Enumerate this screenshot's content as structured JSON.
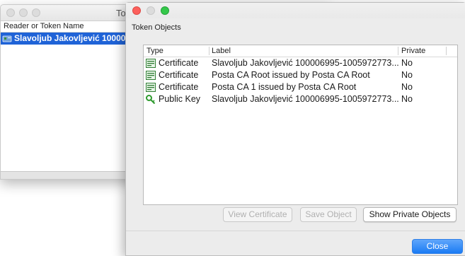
{
  "back_window": {
    "title": "Tok",
    "column_header": "Reader or Token Name",
    "selected_row": "Slavoljub Jakovljević 10000"
  },
  "front_window": {
    "section_label": "Token Objects",
    "columns": {
      "type": "Type",
      "label": "Label",
      "private": "Private"
    },
    "rows": [
      {
        "icon": "certificate-icon",
        "type": "Certificate",
        "label": "Slavoljub Jakovljević 100006995-1005972773...",
        "private": "No"
      },
      {
        "icon": "certificate-icon",
        "type": "Certificate",
        "label": "Posta CA Root issued by Posta CA Root",
        "private": "No"
      },
      {
        "icon": "certificate-icon",
        "type": "Certificate",
        "label": "Posta CA 1 issued by Posta CA Root",
        "private": "No"
      },
      {
        "icon": "key-icon",
        "type": "Public Key",
        "label": "Slavoljub Jakovljević 100006995-1005972773...",
        "private": "No"
      }
    ],
    "buttons": {
      "view_certificate": "View Certificate",
      "save_object": "Save Object",
      "show_private": "Show Private Objects",
      "close": "Close"
    }
  },
  "colors": {
    "selection_blue": "#1f63d7",
    "close_red": "#fc605c",
    "zoom_green": "#34c84a",
    "primary_button": "#1a7bf4"
  }
}
